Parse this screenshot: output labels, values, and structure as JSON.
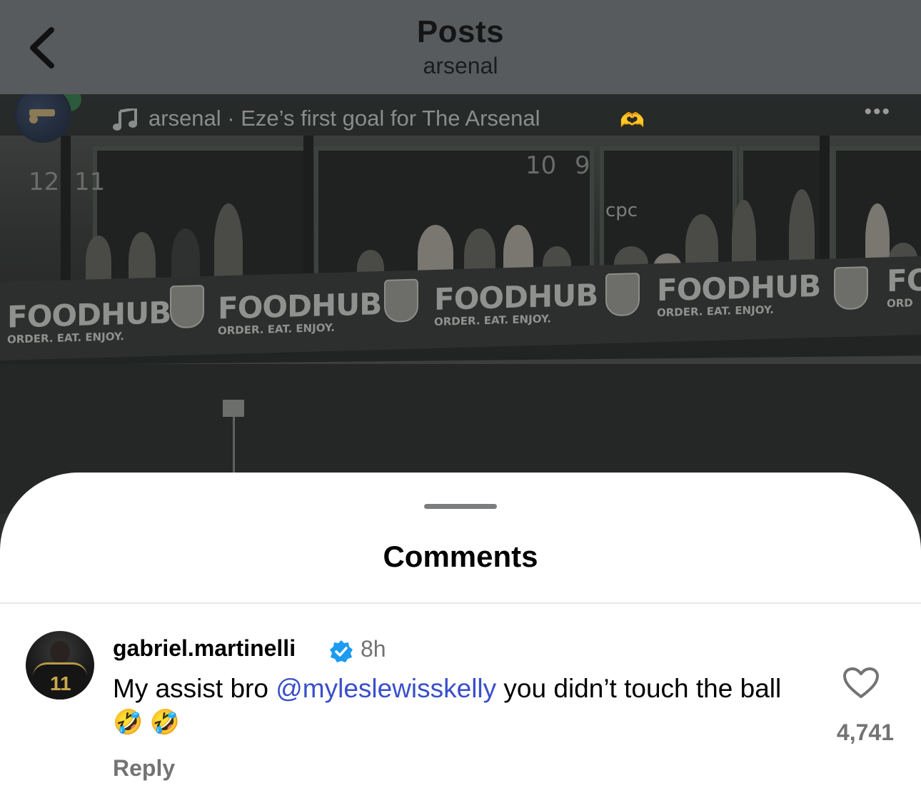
{
  "header": {
    "title": "Posts",
    "subtitle": "arsenal",
    "back_icon": "chevron-left-icon"
  },
  "post": {
    "audio_text": "arsenal · Eze’s first goal for The Arsenal",
    "audio_emoji": "🫶",
    "more_icon": "more-horizontal-icon",
    "music_icon": "music-note-icon",
    "background": {
      "ad_brand": "FOODHUB",
      "ad_tagline": "ORDER. EAT. ENJOY.",
      "ad_partial_brand": "FO",
      "ad_partial_tagline": "ORD",
      "stand_numbers": [
        "12",
        "11",
        "10",
        "9"
      ],
      "sponsor_sign": "cpc"
    }
  },
  "comments_sheet": {
    "title": "Comments",
    "comment": {
      "username": "gabriel.martinelli",
      "verified": true,
      "time": "8h",
      "text_before": "My assist bro ",
      "mention": "@myleslewisskelly",
      "text_after": " you didn’t touch the ball ",
      "emojis": "🤣 🤣",
      "like_count": "4,741",
      "reply_label": "Reply",
      "avatar_jersey_number": "11"
    }
  },
  "colors": {
    "header_bg": "#575b5e",
    "mention": "#3a4fc9",
    "verified": "#1d9bf0",
    "muted": "#737373"
  }
}
